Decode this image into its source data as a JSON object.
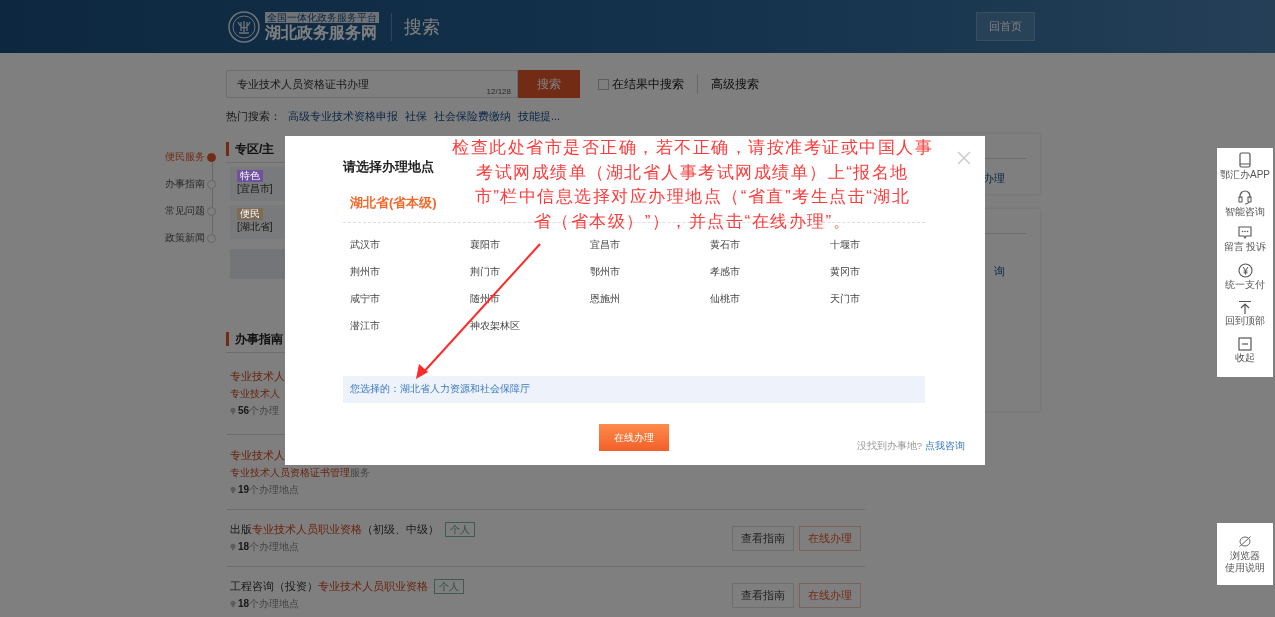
{
  "header": {
    "logo_tagline": "全国一体化政务服务平台",
    "logo_name": "湖北政务服务网",
    "page_title": "搜索",
    "home_button": "回首页"
  },
  "search": {
    "value": "专业技术人员资格证书办理",
    "counter": "12/128",
    "button": "搜索",
    "in_results": {
      "label": "在结果中搜索",
      "checked": false
    },
    "advanced": "高级搜索"
  },
  "hot_search": {
    "label": "热门搜索：",
    "links": [
      "高级专业技术资格申报",
      "社保",
      "社会保险费缴纳",
      "技能提..."
    ]
  },
  "side_nav": [
    {
      "label": "便民服务",
      "selected": true
    },
    {
      "label": "办事指南",
      "selected": false
    },
    {
      "label": "常见问题",
      "selected": false
    },
    {
      "label": "政策新闻",
      "selected": false
    }
  ],
  "zone": {
    "heading": "专区/主",
    "cards": [
      {
        "tag": "特色",
        "color": "#6e52a0",
        "text": "[宜昌市]"
      },
      {
        "tag": "便民",
        "color": "#7e6a55",
        "text": "[湖北省]"
      }
    ]
  },
  "guide": {
    "heading": "办事指南",
    "results": [
      {
        "title": [
          {
            "text": "专业技术人",
            "highlight": true
          }
        ],
        "subtitle": [
          {
            "text": "专业技术人",
            "highlight": true
          }
        ],
        "count": "56",
        "sites": "个办理"
      },
      {
        "title": [
          {
            "text": "专业技术人",
            "highlight": true
          }
        ],
        "subtitle": [
          {
            "text": "专业技术人员资格证书管理",
            "highlight": true
          },
          {
            "text": "服务",
            "highlight": false
          }
        ],
        "count": "19",
        "sites": "个办理地点"
      },
      {
        "title": [
          {
            "text": "出版",
            "highlight": false
          },
          {
            "text": "专业技术人员职业资格",
            "highlight": true
          },
          {
            "text": "（初级、中级）",
            "highlight": false
          }
        ],
        "tag": "个人",
        "count": "18",
        "sites": "个办理地点",
        "buttons": [
          "查看指南",
          "在线办理"
        ]
      },
      {
        "title": [
          {
            "text": "工程咨询（投资）",
            "highlight": false
          },
          {
            "text": "专业技术人员职业资格",
            "highlight": true
          }
        ],
        "tag": "个人",
        "count": "18",
        "sites": "个办理地点",
        "buttons": [
          "查看指南",
          "在线办理"
        ]
      }
    ]
  },
  "right_panel": {
    "cards": [
      {
        "text": "办理"
      },
      {
        "text": "询"
      }
    ]
  },
  "tools": [
    {
      "kind": "phone",
      "label": "鄂汇办APP"
    },
    {
      "kind": "headset",
      "label": "智能咨询"
    },
    {
      "kind": "chat",
      "label": "留言 投诉"
    },
    {
      "kind": "yuan",
      "label": "统一支付"
    },
    {
      "kind": "top",
      "label": "回到顶部"
    },
    {
      "kind": "collapse",
      "label": "收起"
    }
  ],
  "browser_help": {
    "lines": [
      "浏览器",
      "使用说明"
    ]
  },
  "modal": {
    "title": "请选择办理地点",
    "province_tab": {
      "label": "湖北省(省本级)",
      "selected": true
    },
    "cities": [
      "武汉市",
      "襄阳市",
      "宜昌市",
      "黄石市",
      "十堰市",
      "荆州市",
      "荆门市",
      "鄂州市",
      "孝感市",
      "黄冈市",
      "咸宁市",
      "随州市",
      "恩施州",
      "仙桃市",
      "天门市",
      "潜江市",
      "神农架林区"
    ],
    "chosen_label": "您选择的：",
    "chosen_value": "湖北省人力资源和社会保障厅",
    "submit": "在线办理",
    "help_text": "没找到办事地?",
    "help_link": "点我咨询"
  },
  "annotation": {
    "lines": [
      "检查此处省市是否正确，若不正确，请按准考证或中国人事",
      "考试网成绩单（湖北省人事考试网成绩单）上“报名地",
      "市”栏中信息选择对应办理地点（“省直”考生点击“湖北",
      "省（省本级）”），并点击“在线办理”。"
    ]
  }
}
